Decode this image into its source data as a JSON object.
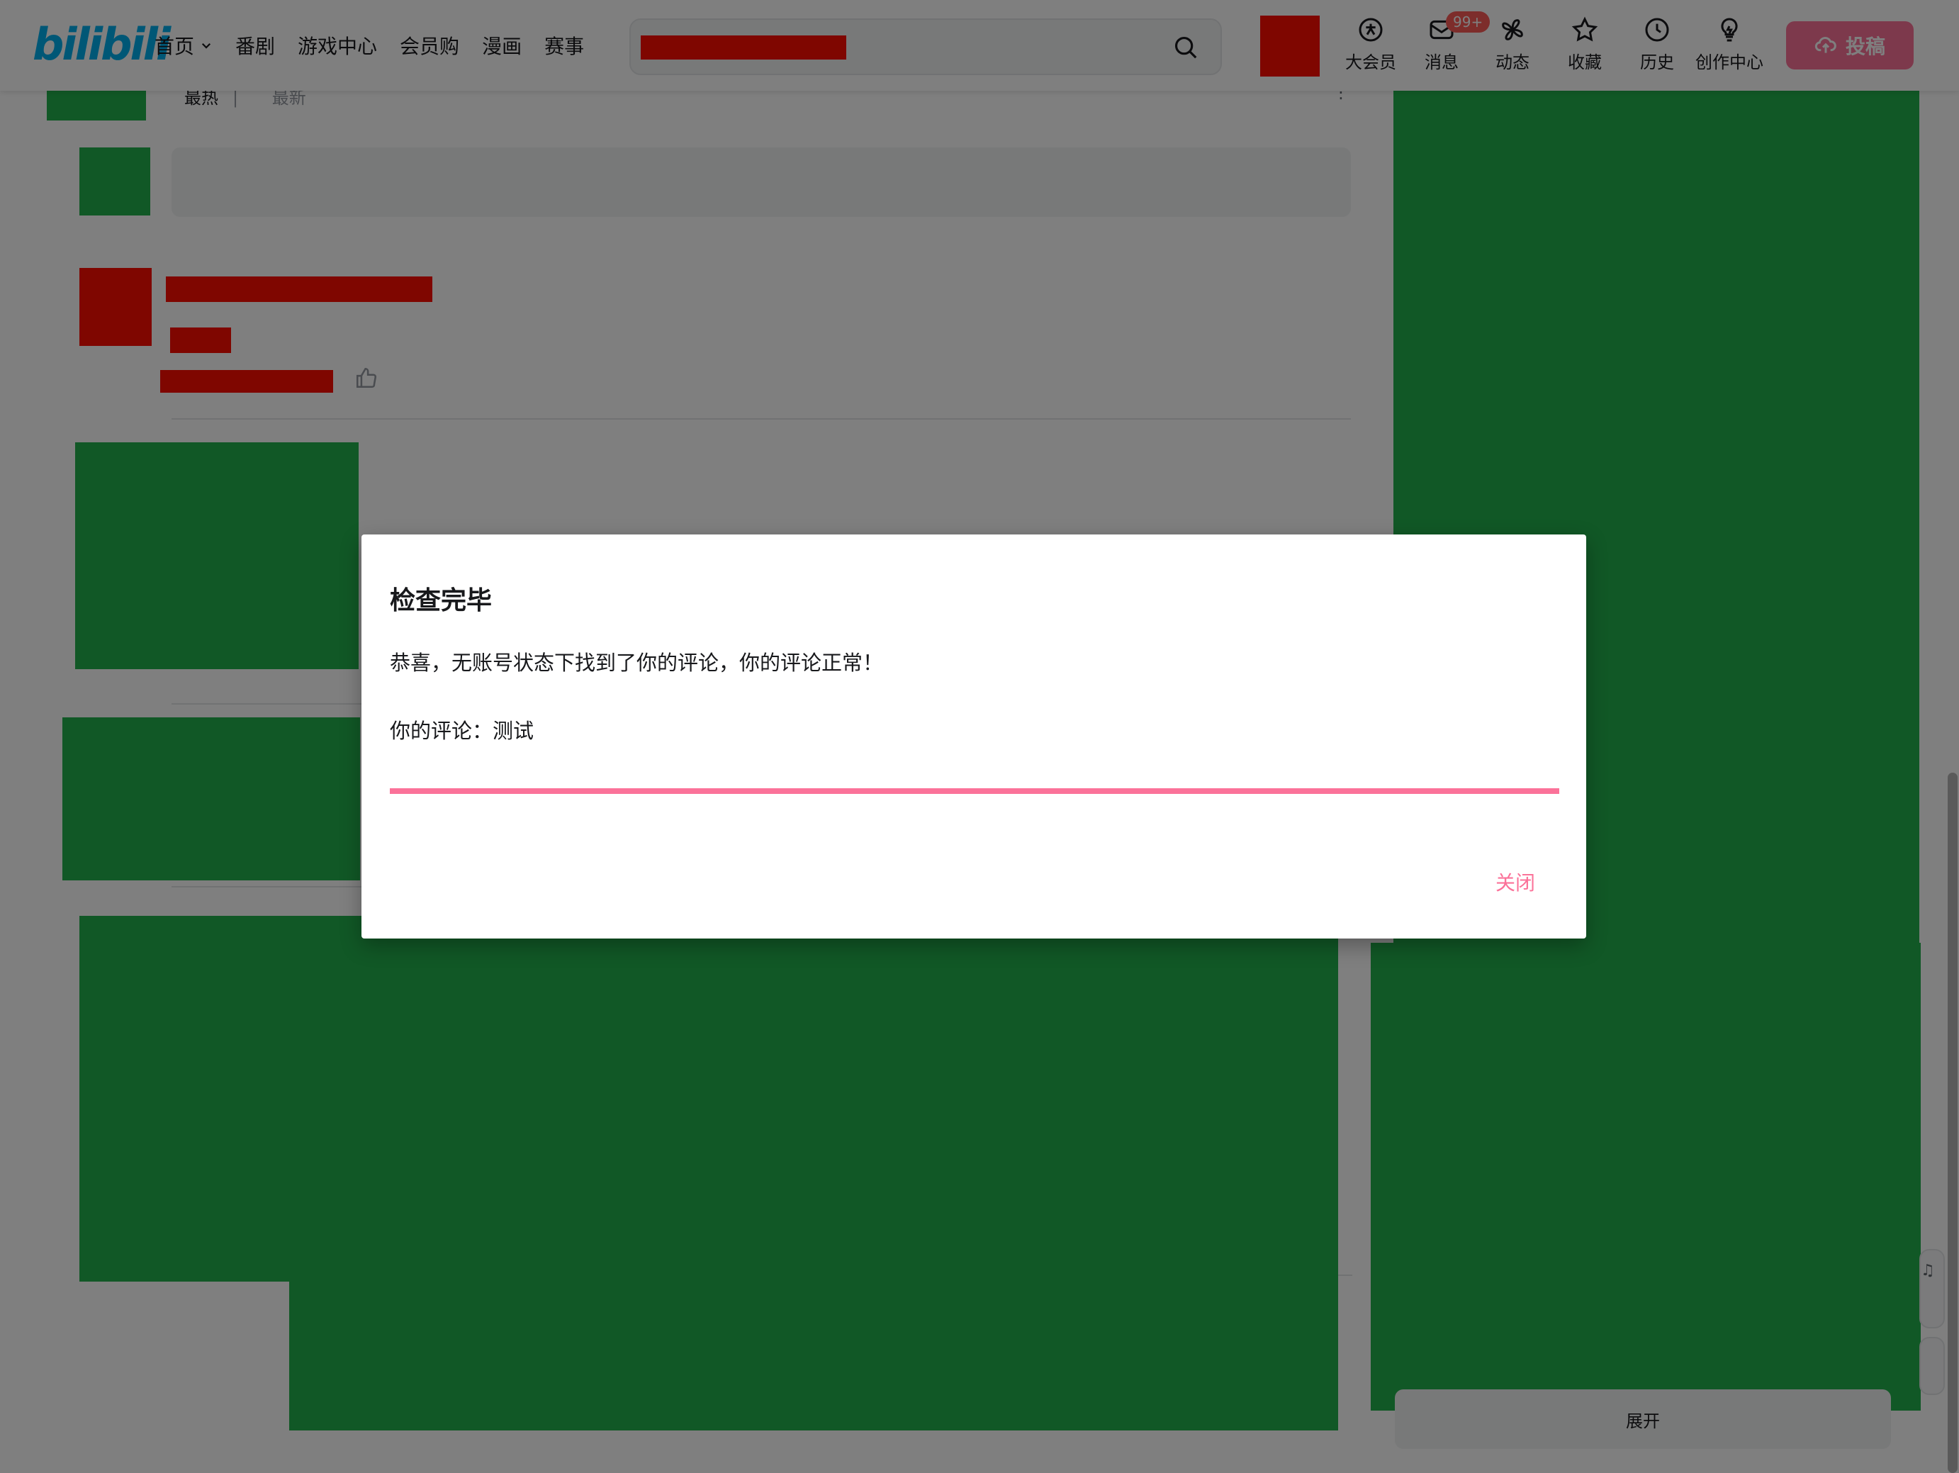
{
  "header": {
    "logo": "bilibili",
    "nav": [
      {
        "label": "首页",
        "has_dropdown": true
      },
      {
        "label": "番剧"
      },
      {
        "label": "游戏中心"
      },
      {
        "label": "会员购"
      },
      {
        "label": "漫画"
      },
      {
        "label": "赛事"
      }
    ],
    "search": {
      "placeholder": ""
    },
    "actions": [
      {
        "label": "大会员",
        "icon": "vip-icon"
      },
      {
        "label": "消息",
        "icon": "message-icon",
        "badge": "99+"
      },
      {
        "label": "动态",
        "icon": "pinwheel-icon"
      },
      {
        "label": "收藏",
        "icon": "star-icon"
      },
      {
        "label": "历史",
        "icon": "clock-icon"
      },
      {
        "label": "创作中心",
        "icon": "lightbulb-icon"
      }
    ],
    "upload_label": "投稿"
  },
  "comments": {
    "sort_hot": "最热",
    "sort_new": "最新",
    "sort_separator": "|"
  },
  "sidebar": {
    "expand_label": "展开"
  },
  "dialog": {
    "title": "检查完毕",
    "message": "恭喜，无账号状态下找到了你的评论，你的评论正常！",
    "comment_line": "你的评论：测试",
    "progress_percent": 100,
    "close_label": "关闭"
  },
  "colors": {
    "brand_pink": "#fb7299",
    "brand_blue": "#00aeec",
    "redaction_green": "#22b14c",
    "redaction_red": "#ff0d00",
    "badge_red": "#fa5a57"
  }
}
